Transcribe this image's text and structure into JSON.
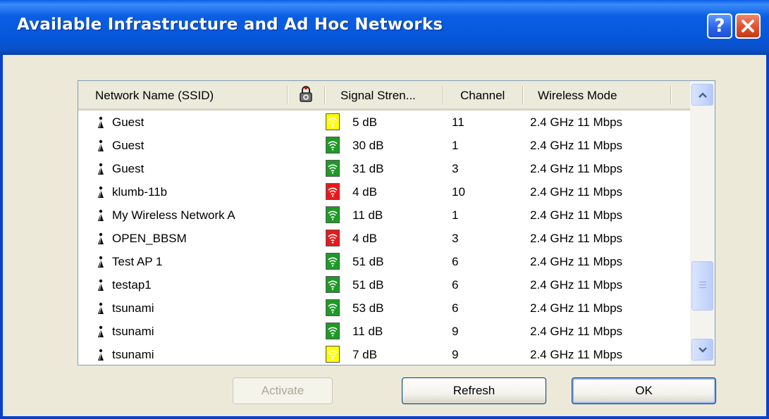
{
  "window": {
    "title": "Available Infrastructure and Ad Hoc Networks",
    "help_label": "?"
  },
  "list": {
    "columns": {
      "ssid": "Network Name (SSID)",
      "signal": "Signal Stren...",
      "channel": "Channel",
      "mode": "Wireless Mode"
    },
    "rows": [
      {
        "ssid": "Guest",
        "signal": "5 dB",
        "channel": "11",
        "mode": "2.4 GHz 11 Mbps",
        "strength_color": "#ffff00"
      },
      {
        "ssid": "Guest",
        "signal": "30 dB",
        "channel": "1",
        "mode": "2.4 GHz 11 Mbps",
        "strength_color": "#1e9a26"
      },
      {
        "ssid": "Guest",
        "signal": "31 dB",
        "channel": "3",
        "mode": "2.4 GHz 11 Mbps",
        "strength_color": "#1e9a26"
      },
      {
        "ssid": "klumb-11b",
        "signal": "4 dB",
        "channel": "10",
        "mode": "2.4 GHz 11 Mbps",
        "strength_color": "#e8191b"
      },
      {
        "ssid": "My Wireless Network A",
        "signal": "11 dB",
        "channel": "1",
        "mode": "2.4 GHz 11 Mbps",
        "strength_color": "#1e9a26"
      },
      {
        "ssid": "OPEN_BBSM",
        "signal": "4 dB",
        "channel": "3",
        "mode": "2.4 GHz 11 Mbps",
        "strength_color": "#e8191b"
      },
      {
        "ssid": "Test AP 1",
        "signal": "51 dB",
        "channel": "6",
        "mode": "2.4 GHz 11 Mbps",
        "strength_color": "#1e9a26"
      },
      {
        "ssid": "testap1",
        "signal": "51 dB",
        "channel": "6",
        "mode": "2.4 GHz 11 Mbps",
        "strength_color": "#1e9a26"
      },
      {
        "ssid": "tsunami",
        "signal": "53 dB",
        "channel": "6",
        "mode": "2.4 GHz 11 Mbps",
        "strength_color": "#1e9a26"
      },
      {
        "ssid": "tsunami",
        "signal": "11 dB",
        "channel": "9",
        "mode": "2.4 GHz 11 Mbps",
        "strength_color": "#1e9a26"
      },
      {
        "ssid": "tsunami",
        "signal": "7 dB",
        "channel": "9",
        "mode": "2.4 GHz 11 Mbps",
        "strength_color": "#ffff00"
      }
    ],
    "scroll_position": 0.72
  },
  "buttons": {
    "activate": "Activate",
    "refresh": "Refresh",
    "ok": "OK"
  },
  "icons": {
    "network": "access-point-icon",
    "security": "lock-icon",
    "signal": "wifi-signal-icon"
  }
}
